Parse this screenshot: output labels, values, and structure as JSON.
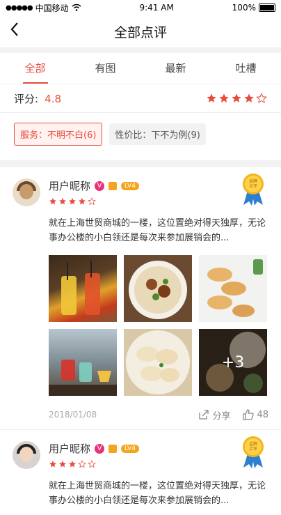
{
  "status_bar": {
    "carrier": "中国移动",
    "time": "9:41 AM",
    "battery": "100%"
  },
  "nav": {
    "title": "全部点评"
  },
  "tabs": [
    {
      "label": "全部",
      "active": true
    },
    {
      "label": "有图",
      "active": false
    },
    {
      "label": "最新",
      "active": false
    },
    {
      "label": "吐槽",
      "active": false
    }
  ],
  "score": {
    "label": "评分:",
    "value": "4.8",
    "stars_filled": 4,
    "stars_total": 5
  },
  "tags": [
    {
      "label": "服务：不明不白(6)",
      "selected": true
    },
    {
      "label": "性价比：下不为例(9)",
      "selected": false
    }
  ],
  "reviews": [
    {
      "username": "用户昵称",
      "vip_badge": "V",
      "level": "LV4",
      "stars_filled": 4,
      "stars_total": 5,
      "medal_text": "金牌\n点评",
      "text": "就在上海世贸商城的一楼，这位置绝对得天独厚，无论事办公楼的小白领还是每次来参加展销会的...",
      "photo_more": "+3",
      "date": "2018/01/08",
      "share_label": "分享",
      "like_count": "48"
    },
    {
      "username": "用户昵称",
      "vip_badge": "V",
      "level": "LV4",
      "stars_filled": 3,
      "stars_total": 5,
      "medal_text": "金牌\n点评",
      "text": "就在上海世贸商城的一楼，这位置绝对得天独厚，无论事办公楼的小白领还是每次来参加展销会的..."
    }
  ],
  "colors": {
    "accent": "#e84c3d",
    "star": "#e84c3d",
    "gold": "#f3a51d",
    "vip": "#e8317a"
  },
  "icons": [
    "back-chevron-icon",
    "wifi-icon",
    "battery-icon",
    "star-icon",
    "vip-badge-icon",
    "crown-icon",
    "medal-icon",
    "share-icon",
    "thumbs-up-icon"
  ]
}
